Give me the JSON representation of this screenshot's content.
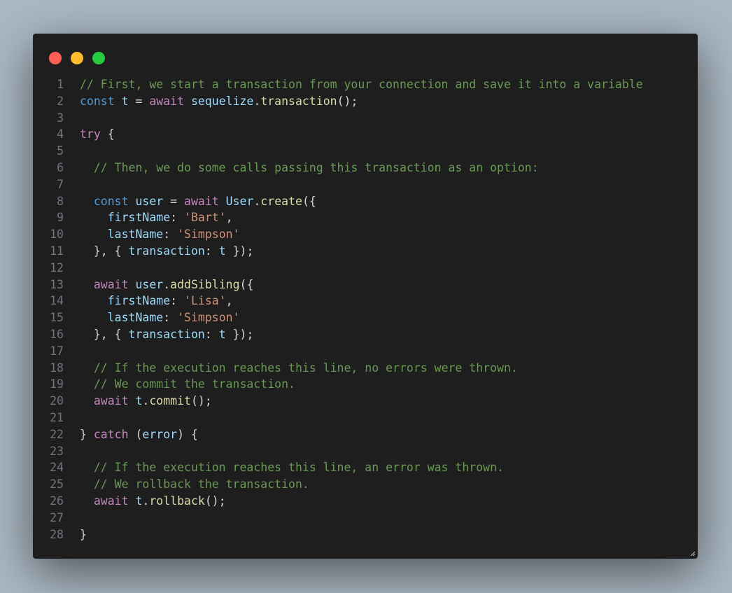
{
  "window": {
    "controls": [
      {
        "name": "close",
        "color": "#ff5f56"
      },
      {
        "name": "minimize",
        "color": "#ffbd2e"
      },
      {
        "name": "maximize",
        "color": "#27c93f"
      }
    ]
  },
  "colors": {
    "comment": "#6a9955",
    "keyword": "#569cd6",
    "control": "#c586c0",
    "variable": "#9cdcfe",
    "function": "#dcdcaa",
    "string": "#ce9178",
    "text": "#d4d4d4"
  },
  "lines": [
    {
      "n": "1",
      "tokens": [
        [
          "c",
          "// First, we start a transaction from your connection and save it into a variable"
        ]
      ]
    },
    {
      "n": "2",
      "tokens": [
        [
          "k",
          "const"
        ],
        [
          "p",
          " "
        ],
        [
          "v",
          "t"
        ],
        [
          "p",
          " = "
        ],
        [
          "x",
          "await"
        ],
        [
          "p",
          " "
        ],
        [
          "v",
          "sequelize"
        ],
        [
          "p",
          "."
        ],
        [
          "f",
          "transaction"
        ],
        [
          "p",
          "();"
        ]
      ]
    },
    {
      "n": "3",
      "tokens": []
    },
    {
      "n": "4",
      "tokens": [
        [
          "x",
          "try"
        ],
        [
          "p",
          " {"
        ]
      ]
    },
    {
      "n": "5",
      "tokens": []
    },
    {
      "n": "6",
      "tokens": [
        [
          "p",
          "  "
        ],
        [
          "c",
          "// Then, we do some calls passing this transaction as an option:"
        ]
      ]
    },
    {
      "n": "7",
      "tokens": []
    },
    {
      "n": "8",
      "tokens": [
        [
          "p",
          "  "
        ],
        [
          "k",
          "const"
        ],
        [
          "p",
          " "
        ],
        [
          "v",
          "user"
        ],
        [
          "p",
          " = "
        ],
        [
          "x",
          "await"
        ],
        [
          "p",
          " "
        ],
        [
          "v",
          "User"
        ],
        [
          "p",
          "."
        ],
        [
          "f",
          "create"
        ],
        [
          "p",
          "({"
        ]
      ]
    },
    {
      "n": "9",
      "tokens": [
        [
          "p",
          "    "
        ],
        [
          "v",
          "firstName"
        ],
        [
          "p",
          ": "
        ],
        [
          "s",
          "'Bart'"
        ],
        [
          "p",
          ","
        ]
      ]
    },
    {
      "n": "10",
      "tokens": [
        [
          "p",
          "    "
        ],
        [
          "v",
          "lastName"
        ],
        [
          "p",
          ": "
        ],
        [
          "s",
          "'Simpson'"
        ]
      ]
    },
    {
      "n": "11",
      "tokens": [
        [
          "p",
          "  }, { "
        ],
        [
          "v",
          "transaction"
        ],
        [
          "p",
          ": "
        ],
        [
          "v",
          "t"
        ],
        [
          "p",
          " });"
        ]
      ]
    },
    {
      "n": "12",
      "tokens": []
    },
    {
      "n": "13",
      "tokens": [
        [
          "p",
          "  "
        ],
        [
          "x",
          "await"
        ],
        [
          "p",
          " "
        ],
        [
          "v",
          "user"
        ],
        [
          "p",
          "."
        ],
        [
          "f",
          "addSibling"
        ],
        [
          "p",
          "({"
        ]
      ]
    },
    {
      "n": "14",
      "tokens": [
        [
          "p",
          "    "
        ],
        [
          "v",
          "firstName"
        ],
        [
          "p",
          ": "
        ],
        [
          "s",
          "'Lisa'"
        ],
        [
          "p",
          ","
        ]
      ]
    },
    {
      "n": "15",
      "tokens": [
        [
          "p",
          "    "
        ],
        [
          "v",
          "lastName"
        ],
        [
          "p",
          ": "
        ],
        [
          "s",
          "'Simpson'"
        ]
      ]
    },
    {
      "n": "16",
      "tokens": [
        [
          "p",
          "  }, { "
        ],
        [
          "v",
          "transaction"
        ],
        [
          "p",
          ": "
        ],
        [
          "v",
          "t"
        ],
        [
          "p",
          " });"
        ]
      ]
    },
    {
      "n": "17",
      "tokens": []
    },
    {
      "n": "18",
      "tokens": [
        [
          "p",
          "  "
        ],
        [
          "c",
          "// If the execution reaches this line, no errors were thrown."
        ]
      ]
    },
    {
      "n": "19",
      "tokens": [
        [
          "p",
          "  "
        ],
        [
          "c",
          "// We commit the transaction."
        ]
      ]
    },
    {
      "n": "20",
      "tokens": [
        [
          "p",
          "  "
        ],
        [
          "x",
          "await"
        ],
        [
          "p",
          " "
        ],
        [
          "v",
          "t"
        ],
        [
          "p",
          "."
        ],
        [
          "f",
          "commit"
        ],
        [
          "p",
          "();"
        ]
      ]
    },
    {
      "n": "21",
      "tokens": []
    },
    {
      "n": "22",
      "tokens": [
        [
          "p",
          "} "
        ],
        [
          "x",
          "catch"
        ],
        [
          "p",
          " ("
        ],
        [
          "v",
          "error"
        ],
        [
          "p",
          ") {"
        ]
      ]
    },
    {
      "n": "23",
      "tokens": []
    },
    {
      "n": "24",
      "tokens": [
        [
          "p",
          "  "
        ],
        [
          "c",
          "// If the execution reaches this line, an error was thrown."
        ]
      ]
    },
    {
      "n": "25",
      "tokens": [
        [
          "p",
          "  "
        ],
        [
          "c",
          "// We rollback the transaction."
        ]
      ]
    },
    {
      "n": "26",
      "tokens": [
        [
          "p",
          "  "
        ],
        [
          "x",
          "await"
        ],
        [
          "p",
          " "
        ],
        [
          "v",
          "t"
        ],
        [
          "p",
          "."
        ],
        [
          "f",
          "rollback"
        ],
        [
          "p",
          "();"
        ]
      ]
    },
    {
      "n": "27",
      "tokens": []
    },
    {
      "n": "28",
      "tokens": [
        [
          "p",
          "}"
        ]
      ]
    }
  ]
}
